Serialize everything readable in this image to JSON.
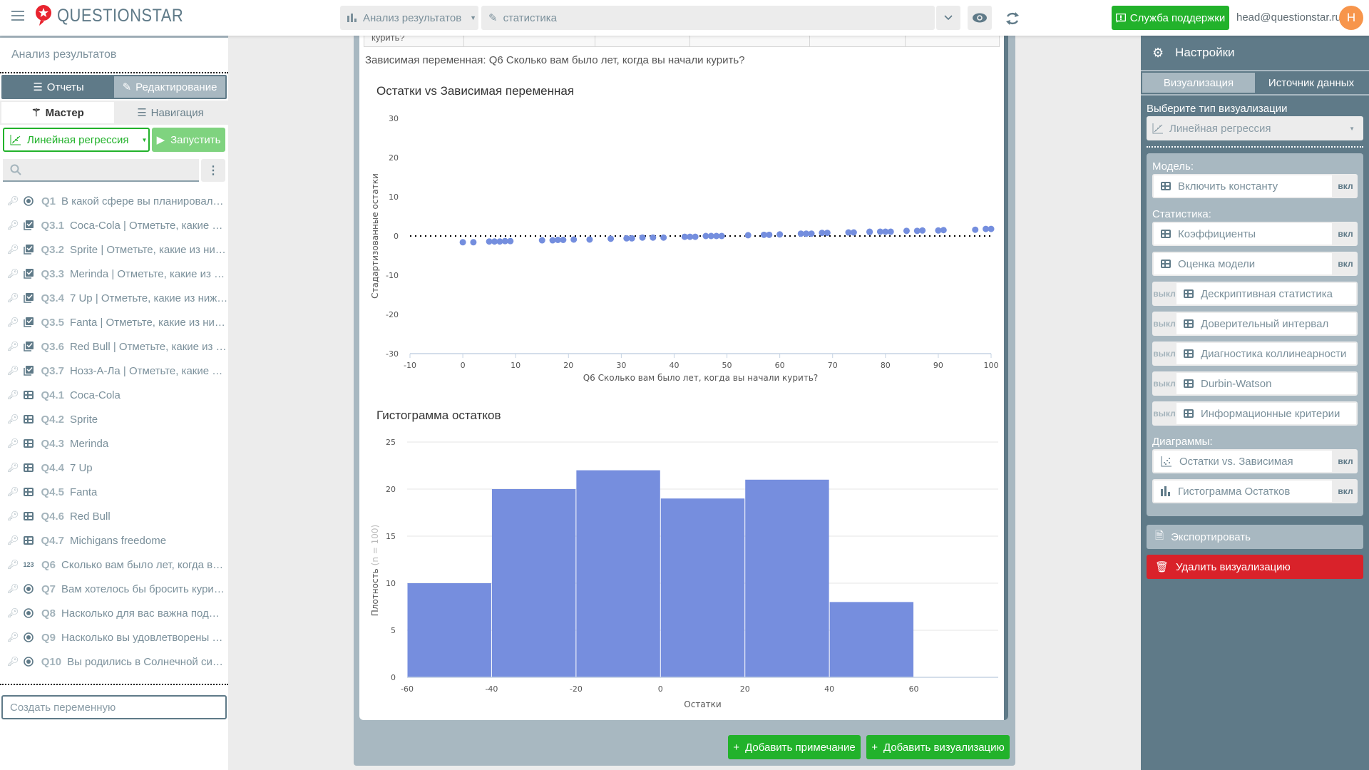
{
  "header": {
    "brand": "QUESTIONSTAR",
    "analysis_dropdown": "Анализ результатов",
    "title_field": "статистика",
    "support_button": "Служба поддержки",
    "user_email": "head@questionstar.ru",
    "avatar_initial": "H",
    "colors": {
      "brand_red": "#e8232e",
      "accent_green": "#22b22b",
      "avatar_orange": "#f7954b"
    }
  },
  "sidebar": {
    "title": "Анализ результатов",
    "mode_tabs": [
      "Отчеты",
      "Редактирование"
    ],
    "sub_tabs": [
      "Мастер",
      "Навигация"
    ],
    "viz_type": "Линейная регрессия",
    "run_button": "Запустить",
    "search_placeholder": "",
    "variables": [
      {
        "type": "radio",
        "code": "Q1",
        "text": "В какой сфере вы планировали п..."
      },
      {
        "type": "checkbox",
        "code": "Q3.1",
        "text": "Coca-Cola | Отметьте, какие из ..."
      },
      {
        "type": "checkbox",
        "code": "Q3.2",
        "text": "Sprite | Отметьте, какие из ниже..."
      },
      {
        "type": "checkbox",
        "code": "Q3.3",
        "text": "Merinda | Отметьте, какие из ни..."
      },
      {
        "type": "checkbox",
        "code": "Q3.4",
        "text": "7 Up | Отметьте, какие из нижеп..."
      },
      {
        "type": "checkbox",
        "code": "Q3.5",
        "text": "Fanta | Отметьте, какие из ниже..."
      },
      {
        "type": "checkbox",
        "code": "Q3.6",
        "text": "Red Bull | Отметьте, какие из ни..."
      },
      {
        "type": "checkbox",
        "code": "Q3.7",
        "text": "Нозз-А-Ла | Отметьте, какие из ..."
      },
      {
        "type": "grid",
        "code": "Q4.1",
        "text": "Coca-Cola"
      },
      {
        "type": "grid",
        "code": "Q4.2",
        "text": "Sprite"
      },
      {
        "type": "grid",
        "code": "Q4.3",
        "text": "Merinda"
      },
      {
        "type": "grid",
        "code": "Q4.4",
        "text": "7 Up"
      },
      {
        "type": "grid",
        "code": "Q4.5",
        "text": "Fanta"
      },
      {
        "type": "grid",
        "code": "Q4.6",
        "text": "Red Bull"
      },
      {
        "type": "grid",
        "code": "Q4.7",
        "text": "Michigans freedome"
      },
      {
        "type": "numeric",
        "code": "Q6",
        "text": "Сколько вам было лет, когда вы ..."
      },
      {
        "type": "radio",
        "code": "Q7",
        "text": "Вам хотелось бы бросить курить?"
      },
      {
        "type": "radio",
        "code": "Q8",
        "text": "Насколько для вас важна поддер..."
      },
      {
        "type": "radio",
        "code": "Q9",
        "text": "Насколько вы удовлетворены ст..."
      },
      {
        "type": "radio",
        "code": "Q10",
        "text": "Вы родились в Солнечной систе..."
      }
    ],
    "create_variable_placeholder": "Создать переменную"
  },
  "main": {
    "table_fragment": "курить?",
    "dependent_variable_label": "Зависимая переменная: Q6 Сколько вам было лет, когда вы начали курить?",
    "add_note_button": "Добавить примечание",
    "add_viz_button": "Добавить визуализацию"
  },
  "chart_data": [
    {
      "type": "scatter",
      "title": "Остатки vs Зависимая переменная",
      "xlabel": "Q6 Сколько вам было лет, когда вы начали курить?",
      "ylabel": "Стадартизованные остатки",
      "xlim": [
        -10,
        100
      ],
      "ylim": [
        -30,
        30
      ],
      "xticks": [
        -10,
        0,
        10,
        20,
        30,
        40,
        50,
        60,
        70,
        80,
        90,
        100
      ],
      "yticks": [
        30,
        20,
        10,
        0,
        -10,
        -20,
        -30
      ],
      "reference_line": {
        "y": 0,
        "style": "dotted"
      },
      "color": "#748ede",
      "points": [
        [
          0,
          -1.6
        ],
        [
          2,
          -1.6
        ],
        [
          5,
          -1.4
        ],
        [
          6,
          -1.4
        ],
        [
          7,
          -1.4
        ],
        [
          8,
          -1.3
        ],
        [
          9,
          -1.3
        ],
        [
          15,
          -1.1
        ],
        [
          17,
          -1.1
        ],
        [
          18,
          -1.0
        ],
        [
          19,
          -1.0
        ],
        [
          21,
          -0.9
        ],
        [
          24,
          -0.9
        ],
        [
          28,
          -0.7
        ],
        [
          31,
          -0.6
        ],
        [
          32,
          -0.6
        ],
        [
          34,
          -0.4
        ],
        [
          36,
          -0.4
        ],
        [
          38,
          -0.4
        ],
        [
          42,
          -0.2
        ],
        [
          43,
          -0.2
        ],
        [
          44,
          -0.2
        ],
        [
          46,
          0.0
        ],
        [
          47,
          0.0
        ],
        [
          48,
          0.0
        ],
        [
          49,
          0.0
        ],
        [
          54,
          0.2
        ],
        [
          57,
          0.3
        ],
        [
          58,
          0.3
        ],
        [
          60,
          0.4
        ],
        [
          64,
          0.6
        ],
        [
          65,
          0.6
        ],
        [
          66,
          0.6
        ],
        [
          68,
          0.8
        ],
        [
          69,
          0.8
        ],
        [
          73,
          0.9
        ],
        [
          74,
          0.9
        ],
        [
          77,
          1.0
        ],
        [
          77,
          1.1
        ],
        [
          79,
          1.1
        ],
        [
          80,
          1.1
        ],
        [
          81,
          1.1
        ],
        [
          84,
          1.3
        ],
        [
          86,
          1.3
        ],
        [
          87,
          1.4
        ],
        [
          90,
          1.4
        ],
        [
          91,
          1.5
        ],
        [
          97,
          1.6
        ],
        [
          99,
          1.8
        ],
        [
          100,
          1.8
        ]
      ]
    },
    {
      "type": "bar",
      "title": "Гистограмма остатков",
      "xlabel": "Остатки",
      "ylabel": "Плотность",
      "ylabel_note": "(n = 100)",
      "xlim": [
        -60,
        80
      ],
      "ylim": [
        0,
        25
      ],
      "xticks": [
        -60,
        -40,
        -20,
        0,
        20,
        40,
        60
      ],
      "yticks": [
        0,
        5,
        10,
        15,
        20,
        25
      ],
      "color": "#768ede",
      "bins": [
        {
          "from": -60,
          "to": -40,
          "value": 10
        },
        {
          "from": -40,
          "to": -20,
          "value": 20
        },
        {
          "from": -20,
          "to": 0,
          "value": 22
        },
        {
          "from": 0,
          "to": 20,
          "value": 19
        },
        {
          "from": 20,
          "to": 40,
          "value": 21
        },
        {
          "from": 40,
          "to": 60,
          "value": 8
        }
      ]
    }
  ],
  "settings": {
    "title": "Настройки",
    "tabs": [
      "Визуализация",
      "Источник данных"
    ],
    "viz_type_label": "Выберите тип визуализации",
    "viz_type_value": "Линейная регрессия",
    "model_label": "Модель:",
    "model_options": [
      {
        "label": "Включить константу",
        "state": "вкл",
        "icon": "grid"
      }
    ],
    "stats_label": "Статистика:",
    "stats_options": [
      {
        "label": "Коэффициенты",
        "state": "вкл",
        "icon": "grid"
      },
      {
        "label": "Оценка модели",
        "state": "вкл",
        "icon": "grid"
      },
      {
        "label": "Дескриптивная статистика",
        "state": "выкл",
        "icon": "grid"
      },
      {
        "label": "Доверительный интервал",
        "state": "выкл",
        "icon": "grid"
      },
      {
        "label": "Диагностика коллинеарности",
        "state": "выкл",
        "icon": "grid"
      },
      {
        "label": "Durbin-Watson",
        "state": "выкл",
        "icon": "grid"
      },
      {
        "label": "Информационные критерии",
        "state": "выкл",
        "icon": "grid"
      }
    ],
    "charts_label": "Диаграммы:",
    "chart_options": [
      {
        "label": "Остатки vs. Зависимая",
        "state": "вкл",
        "icon": "scatter"
      },
      {
        "label": "Гистограмма Остатков",
        "state": "вкл",
        "icon": "bar"
      }
    ],
    "export_button": "Экспортировать",
    "delete_button": "Удалить визуализацию"
  }
}
